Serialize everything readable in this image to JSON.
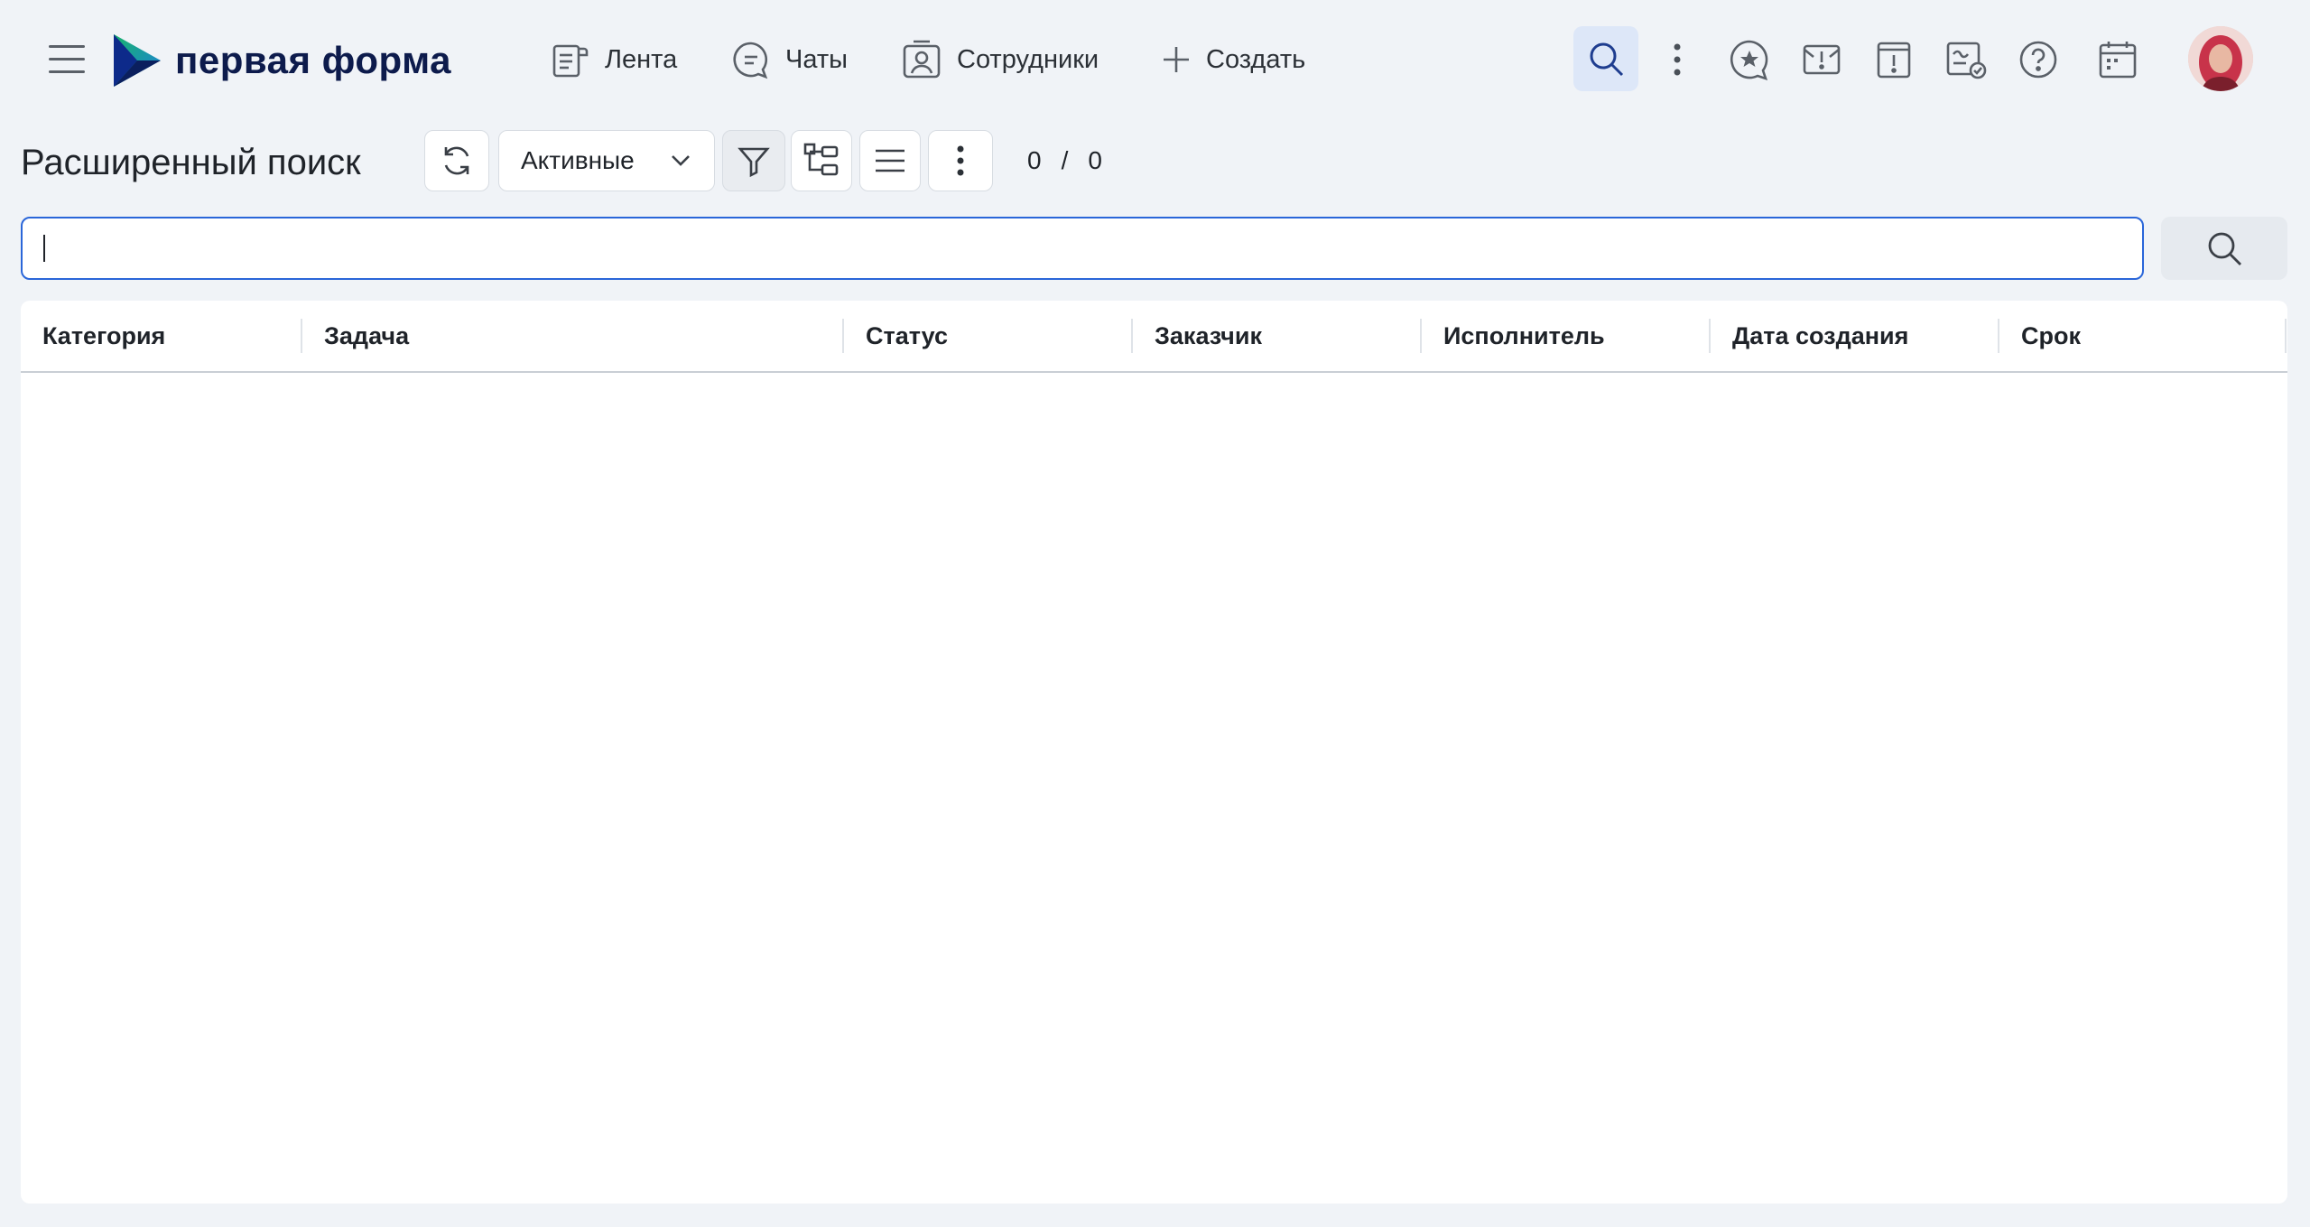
{
  "app": {
    "logo_text": "первая форма"
  },
  "nav": [
    {
      "label": "Лента",
      "icon": "feed-icon"
    },
    {
      "label": "Чаты",
      "icon": "chat-icon"
    },
    {
      "label": "Сотрудники",
      "icon": "employees-icon"
    },
    {
      "label": "Создать",
      "icon": "plus-icon"
    }
  ],
  "header_icons": [
    "search-icon",
    "more-vertical-icon",
    "favorites-icon",
    "important-mail-icon",
    "urgent-icon",
    "approvals-icon",
    "help-icon",
    "calendar-icon"
  ],
  "page": {
    "title": "Расширенный поиск"
  },
  "toolbar": {
    "filter_dropdown": {
      "selected": "Активные"
    },
    "counter": {
      "current": "0",
      "separator": "/",
      "total": "0"
    }
  },
  "search": {
    "value": "",
    "placeholder": ""
  },
  "table": {
    "columns": [
      "Категория",
      "Задача",
      "Статус",
      "Заказчик",
      "Исполнитель",
      "Дата создания",
      "Срок"
    ],
    "rows": []
  },
  "colors": {
    "accent": "#2a66d9",
    "brand_dark": "#0d1b4c",
    "background": "#f0f3f7"
  }
}
